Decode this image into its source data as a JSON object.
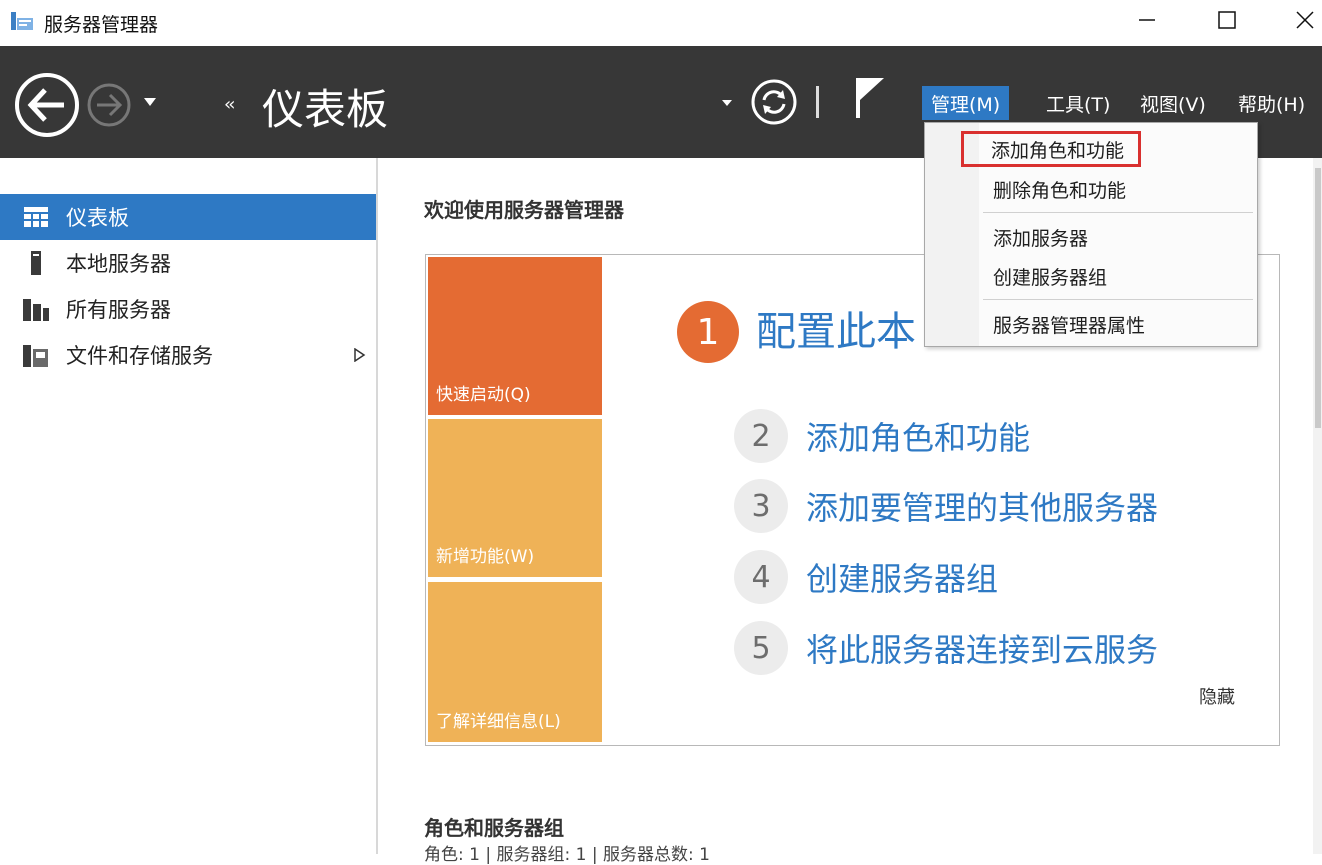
{
  "window": {
    "title": "服务器管理器"
  },
  "header": {
    "breadcrumb_arrows": "‹‹",
    "page_title": "仪表板",
    "menus": [
      {
        "label": "管理(M)",
        "active": true
      },
      {
        "label": "工具(T)",
        "active": false
      },
      {
        "label": "视图(V)",
        "active": false
      },
      {
        "label": "帮助(H)",
        "active": false
      }
    ]
  },
  "manage_menu": {
    "items": [
      {
        "label": "添加角色和功能",
        "highlighted": true
      },
      {
        "label": "删除角色和功能",
        "highlighted": false
      },
      {
        "label": "添加服务器",
        "highlighted": false
      },
      {
        "label": "创建服务器组",
        "highlighted": false
      },
      {
        "label": "服务器管理器属性",
        "highlighted": false
      }
    ]
  },
  "sidebar": {
    "items": [
      {
        "label": "仪表板",
        "icon": "dashboard-icon",
        "selected": true
      },
      {
        "label": "本地服务器",
        "icon": "server-icon",
        "selected": false
      },
      {
        "label": "所有服务器",
        "icon": "servers-icon",
        "selected": false
      },
      {
        "label": "文件和存储服务",
        "icon": "storage-icon",
        "selected": false,
        "expandable": true
      }
    ]
  },
  "main": {
    "welcome_title": "欢迎使用服务器管理器",
    "tiles": [
      {
        "label": "快速启动(Q)"
      },
      {
        "label": "新增功能(W)"
      },
      {
        "label": "了解详细信息(L)"
      }
    ],
    "steps": [
      {
        "num": "1",
        "label": "配置此本"
      },
      {
        "num": "2",
        "label": "添加角色和功能"
      },
      {
        "num": "3",
        "label": "添加要管理的其他服务器"
      },
      {
        "num": "4",
        "label": "创建服务器组"
      },
      {
        "num": "5",
        "label": "将此服务器连接到云服务"
      }
    ],
    "hide_label": "隐藏",
    "roles_title": "角色和服务器组",
    "roles_summary": "角色: 1 | 服务器组: 1 | 服务器总数: 1"
  },
  "colors": {
    "accent": "#2e79c4",
    "header_bg": "#373737",
    "tile_primary": "#e46b33",
    "tile_secondary": "#efb257",
    "highlight_outline": "#d9302f"
  }
}
